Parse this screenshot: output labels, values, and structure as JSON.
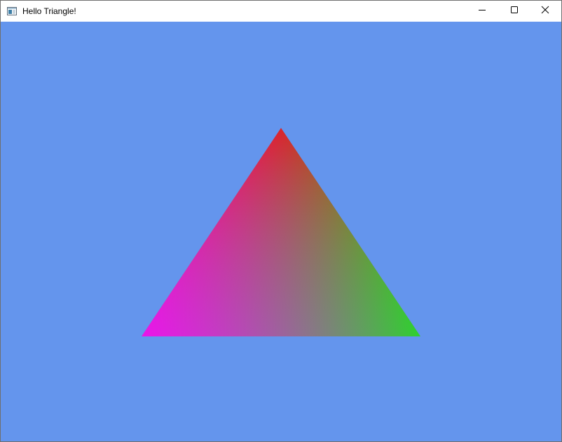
{
  "window": {
    "title": "Hello Triangle!",
    "icons": {
      "app": "app-window-icon",
      "minimize": "minimize-icon",
      "maximize": "maximize-icon",
      "close": "close-icon"
    }
  },
  "scene": {
    "clear_color": "#6495ed",
    "vertex_colors": {
      "top": "#ff0000",
      "bottom_right": "#00ff00",
      "bottom_left": "#ff00ff"
    }
  }
}
